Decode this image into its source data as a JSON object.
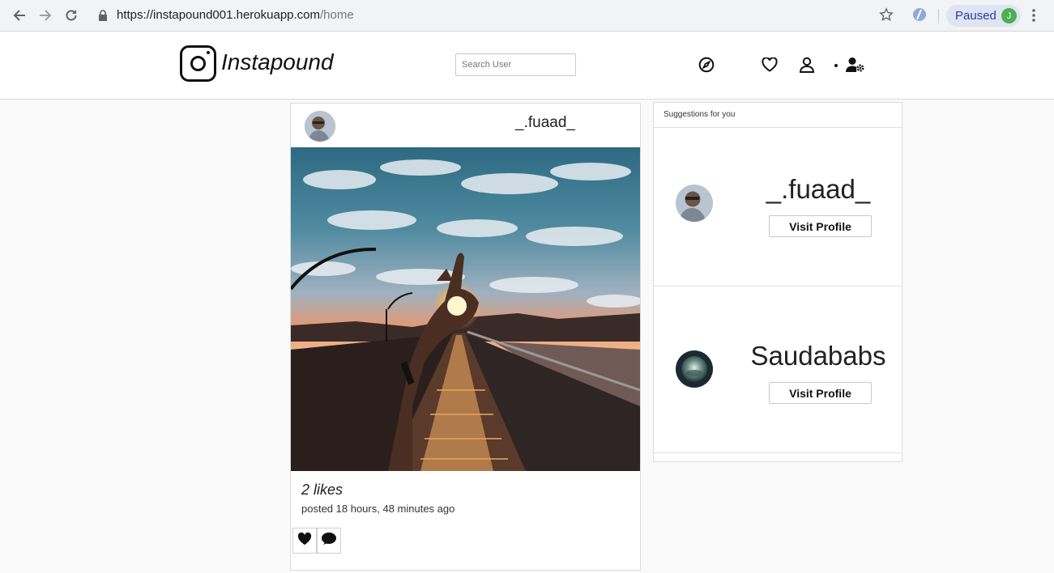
{
  "browser": {
    "url_base": "https://instapound001.herokuapp.com",
    "url_path": "/home",
    "profile_status": "Paused",
    "profile_initial": "J"
  },
  "header": {
    "logo_text": "Instapound",
    "search_placeholder": "Search User"
  },
  "post": {
    "username": "_.fuaad_",
    "likes": "2 likes",
    "posted": "posted 18 hours, 48 minutes ago"
  },
  "suggestions": {
    "title": "Suggestions for you",
    "items": [
      {
        "name": "_.fuaad_",
        "button": "Visit Profile"
      },
      {
        "name": "Saudababs",
        "button": "Visit Profile"
      }
    ]
  }
}
